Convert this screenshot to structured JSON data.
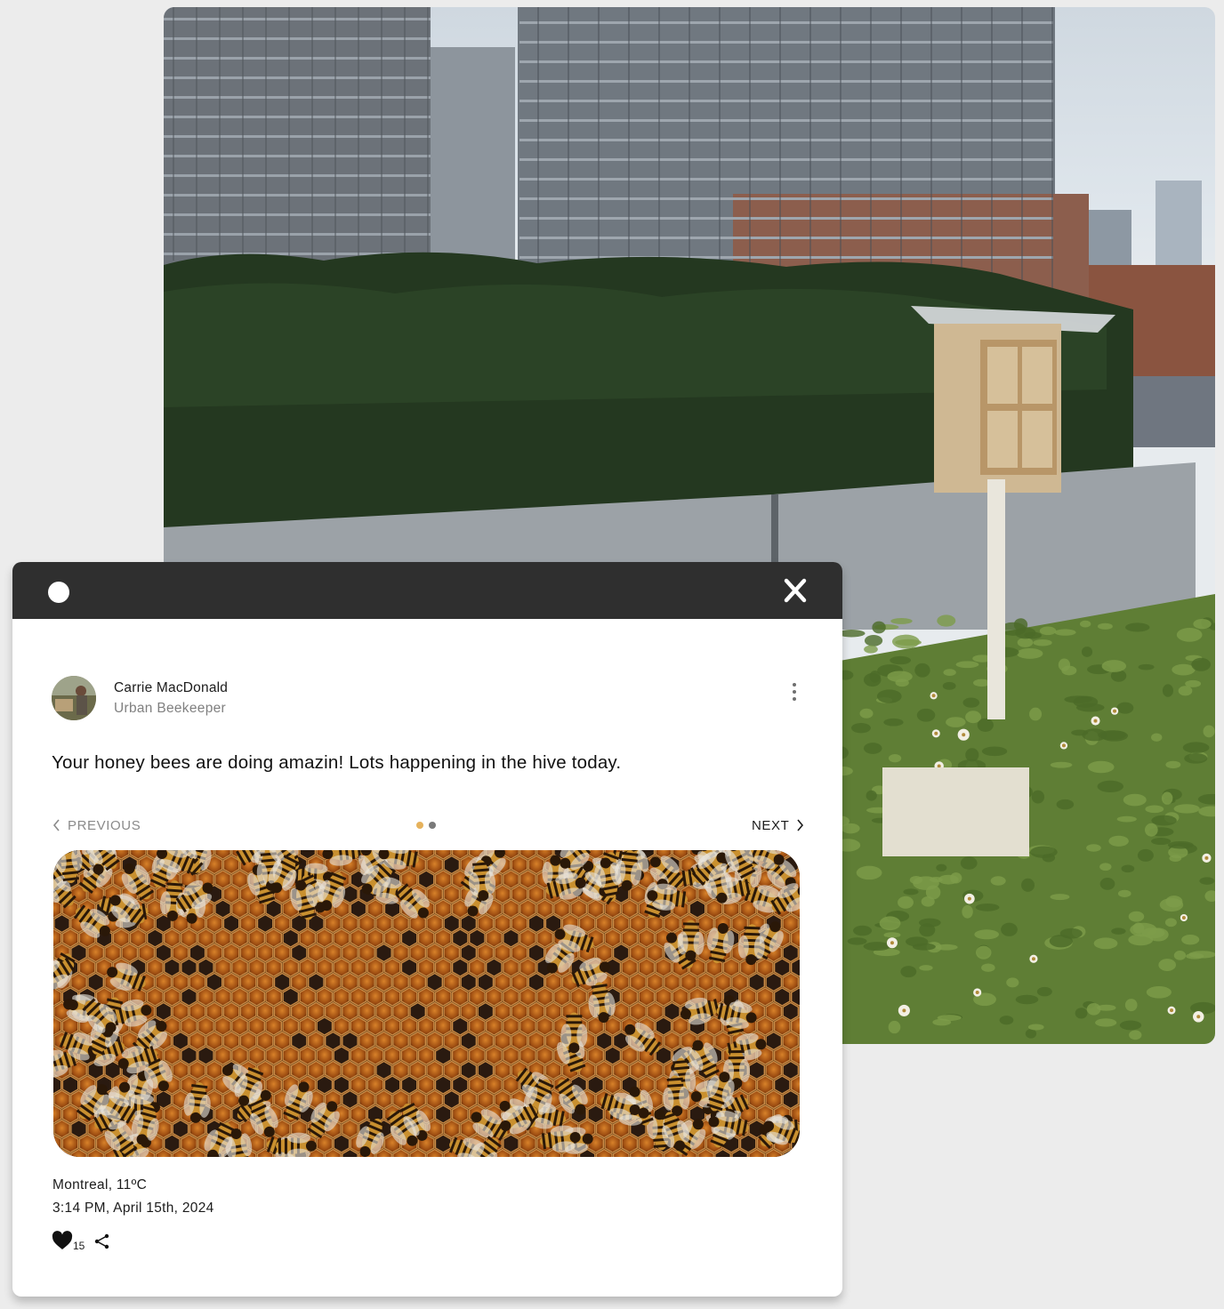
{
  "colors": {
    "titlebar": "#2f2f2f",
    "accent_dot": "#e6b25c",
    "inactive_dot": "#7a7a7a",
    "text_primary": "#1c1c1c",
    "text_secondary": "#808080"
  },
  "window": {
    "dot_icon": "circle-icon",
    "close_icon": "close-x-icon"
  },
  "author": {
    "name": "Carrie MacDonald",
    "role": "Urban Beekeeper"
  },
  "post": {
    "text": "Your honey bees are doing amazin! Lots happening in the hive today.",
    "location": "Montreal, 11ºC",
    "timestamp": "3:14 PM, April 15th, 2024",
    "likes": "15"
  },
  "nav": {
    "previous": "PREVIOUS",
    "next": "NEXT",
    "pages": 2,
    "current_page": 1
  },
  "icons": {
    "more": "more-vertical-icon",
    "like": "heart-icon",
    "share": "share-icon",
    "prev": "chevron-left-icon",
    "next": "chevron-right-icon"
  }
}
